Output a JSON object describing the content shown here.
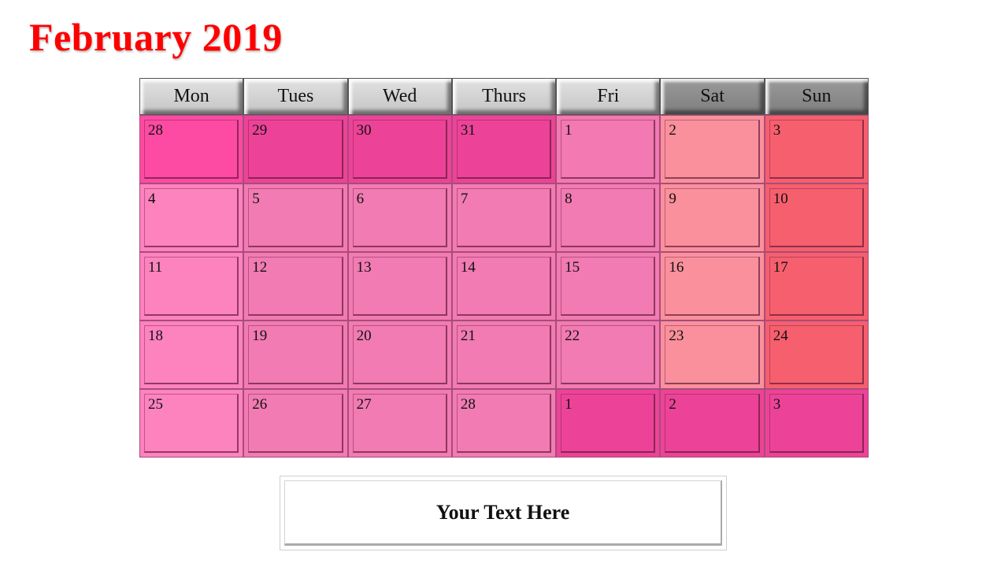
{
  "title": "February 2019",
  "colors": {
    "title": "#ff0000",
    "header_weekday": "#d0d0d0",
    "header_weekend": "#858585"
  },
  "headers": [
    {
      "label": "Mon",
      "type": "weekday"
    },
    {
      "label": "Tues",
      "type": "weekday"
    },
    {
      "label": "Wed",
      "type": "weekday"
    },
    {
      "label": "Thurs",
      "type": "weekday"
    },
    {
      "label": "Fri",
      "type": "weekday"
    },
    {
      "label": "Sat",
      "type": "weekend"
    },
    {
      "label": "Sun",
      "type": "weekend"
    }
  ],
  "weeks": [
    [
      {
        "day": "28",
        "color": "#fd4aa3"
      },
      {
        "day": "29",
        "color": "#ec4398"
      },
      {
        "day": "30",
        "color": "#ec4398"
      },
      {
        "day": "31",
        "color": "#ec4398"
      },
      {
        "day": "1",
        "color": "#f279b2"
      },
      {
        "day": "2",
        "color": "#f9909c"
      },
      {
        "day": "3",
        "color": "#f65f6d"
      }
    ],
    [
      {
        "day": "4",
        "color": "#fd83bf"
      },
      {
        "day": "5",
        "color": "#f17bb2"
      },
      {
        "day": "6",
        "color": "#f17bb2"
      },
      {
        "day": "7",
        "color": "#f17bb2"
      },
      {
        "day": "8",
        "color": "#f17bb2"
      },
      {
        "day": "9",
        "color": "#f9909c"
      },
      {
        "day": "10",
        "color": "#f65f6d"
      }
    ],
    [
      {
        "day": "11",
        "color": "#fd83bf"
      },
      {
        "day": "12",
        "color": "#f17bb2"
      },
      {
        "day": "13",
        "color": "#f17bb2"
      },
      {
        "day": "14",
        "color": "#f17bb2"
      },
      {
        "day": "15",
        "color": "#f17bb2"
      },
      {
        "day": "16",
        "color": "#f9909c"
      },
      {
        "day": "17",
        "color": "#f65f6d"
      }
    ],
    [
      {
        "day": "18",
        "color": "#fd83bf"
      },
      {
        "day": "19",
        "color": "#f17bb2"
      },
      {
        "day": "20",
        "color": "#f17bb2"
      },
      {
        "day": "21",
        "color": "#f17bb2"
      },
      {
        "day": "22",
        "color": "#f17bb2"
      },
      {
        "day": "23",
        "color": "#f9909c"
      },
      {
        "day": "24",
        "color": "#f65f6d"
      }
    ],
    [
      {
        "day": "25",
        "color": "#fd83bf"
      },
      {
        "day": "26",
        "color": "#f17bb2"
      },
      {
        "day": "27",
        "color": "#f17bb2"
      },
      {
        "day": "28",
        "color": "#f17bb2"
      },
      {
        "day": "1",
        "color": "#ec4398"
      },
      {
        "day": "2",
        "color": "#ec4398"
      },
      {
        "day": "3",
        "color": "#ec4398"
      }
    ]
  ],
  "textbox": {
    "text": "Your Text Here"
  }
}
